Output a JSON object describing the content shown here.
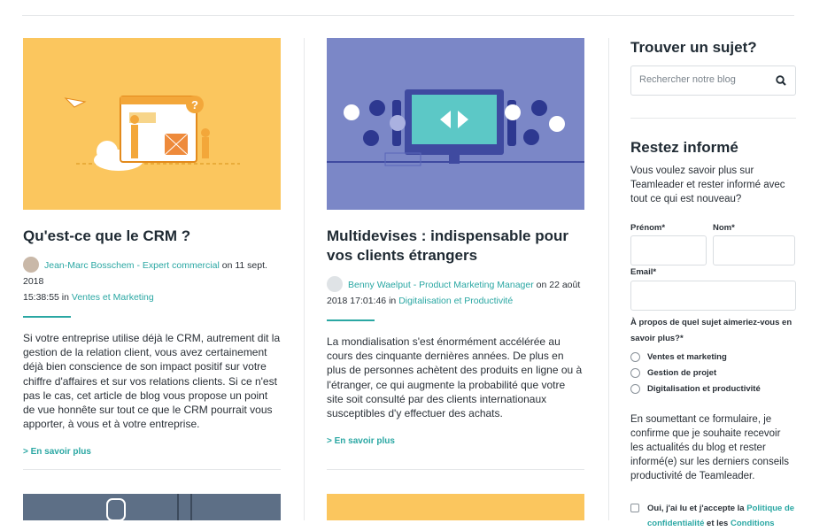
{
  "articles": [
    {
      "title": "Qu'est-ce que le CRM ?",
      "author": "Jean-Marc Bosschem - Expert commercial",
      "on": "on",
      "date_line1": "11 sept. 2018",
      "date_line2": "15:38:55",
      "in": "in",
      "category": "Ventes et Marketing",
      "excerpt": "Si votre entreprise utilise déjà le CRM, autrement dit la gestion de la relation client, vous avez certainement déjà bien conscience de son impact positif sur votre chiffre d'affaires et sur vos relations clients. Si ce n'est pas le cas, cet article de blog vous propose un point de vue honnête sur tout ce que le CRM pourrait vous apporter, à vous et à votre entreprise.",
      "more": "> En savoir plus"
    },
    {
      "title": "Multidevises : indispensable pour vos clients étrangers",
      "author": "Benny Waelput - Product Marketing Manager",
      "on": "on",
      "date_line1": "22 août",
      "date_line2": "2018 17:01:46",
      "in": "in",
      "category": "Digitalisation et Productivité",
      "excerpt": "La mondialisation s'est énormément accélérée au cours des cinquante dernières années. De plus en plus de personnes achètent des produits en ligne ou à l'étranger, ce qui augmente la probabilité que votre site soit consulté par des clients internationaux susceptibles d'y effectuer des achats.",
      "more": "> En savoir plus"
    }
  ],
  "sidebar": {
    "search_title": "Trouver un sujet?",
    "search_placeholder": "Rechercher notre blog",
    "newsletter_title": "Restez informé",
    "newsletter_desc": "Vous voulez savoir plus sur Teamleader et rester informé avec tout ce qui est nouveau?",
    "first_name_label": "Prénom*",
    "last_name_label": "Nom*",
    "email_label": "Email*",
    "topic_question": "À propos de quel sujet aimeriez-vous en savoir plus?*",
    "topics": [
      "Ventes et marketing",
      "Gestion de projet",
      "Digitalisation et productivité"
    ],
    "consent_text": "En soumettant ce formulaire, je confirme que je souhaite recevoir les actualités du blog et rester informé(e) sur les derniers conseils productivité de Teamleader.",
    "checkbox_prefix": "Oui, j'ai lu et j'accepte la",
    "privacy_link": "Politique de confidentialité",
    "and_text": "et les",
    "conditions_link": "Conditions"
  },
  "colors": {
    "accent": "#2aa7a3",
    "thumb1": "#fbc65e",
    "thumb2": "#7b87c7",
    "thumb3": "#5d6f86"
  },
  "icons": [
    "search-icon"
  ]
}
